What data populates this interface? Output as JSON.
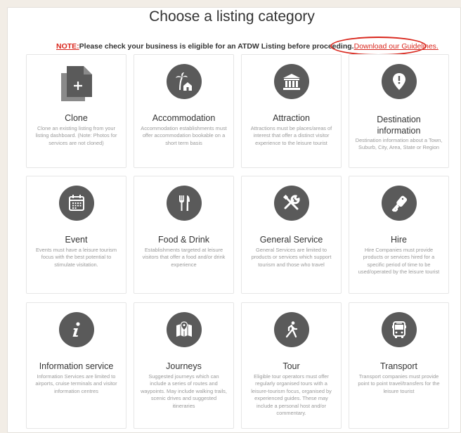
{
  "page": {
    "title": "Choose a listing category",
    "note_label": "NOTE:",
    "note_text": "Please check your business is eligible for an ATDW Listing before proceeding.",
    "guidelines_link": "Download our Guidelines."
  },
  "categories": [
    {
      "title": "Clone",
      "icon": "clone-icon",
      "desc": "Clone an existing listing from your listing dashboard. (Note: Photos for services are not cloned)"
    },
    {
      "title": "Accommodation",
      "icon": "palm-house-icon",
      "desc": "Accommodation establishments must offer accommodation bookable on a short term basis"
    },
    {
      "title": "Attraction",
      "icon": "museum-icon",
      "desc": "Attractions must be places/areas of interest that offer a distinct visitor experience to the leisure tourist"
    },
    {
      "title": "Destination information",
      "icon": "map-pin-icon",
      "desc": "Destination information about a Town, Suburb, City, Area, State or Region"
    },
    {
      "title": "Event",
      "icon": "calendar-icon",
      "desc": "Events must have a leisure tourism focus with the best potential to stimulate visitation."
    },
    {
      "title": "Food & Drink",
      "icon": "fork-knife-icon",
      "desc": "Establishments targeted at leisure visitors that offer a food and/or drink experience"
    },
    {
      "title": "General Service",
      "icon": "tools-icon",
      "desc": "General Services are limited to products or services which support tourism and those who travel"
    },
    {
      "title": "Hire",
      "icon": "key-icon",
      "desc": "Hire Companies must provide products or services hired for a specific period of time to be used/operated by the leisure tourist"
    },
    {
      "title": "Information service",
      "icon": "info-icon",
      "desc": "Information Services are limited to airports, cruise terminals and visitor information centres"
    },
    {
      "title": "Journeys",
      "icon": "map-icon",
      "desc": "Suggested journeys which can include a series of routes and waypoints. May include walking trails, scenic drives and suggested itineraries"
    },
    {
      "title": "Tour",
      "icon": "walking-person-icon",
      "desc": "Eligible tour operators must offer regularly organised tours with a leisure-tourism focus, organised by experienced guides. These may include a personal host and/or commentary."
    },
    {
      "title": "Transport",
      "icon": "bus-icon",
      "desc": "Transport companies must provide point to point travel/transfers for the leisure tourist"
    }
  ]
}
